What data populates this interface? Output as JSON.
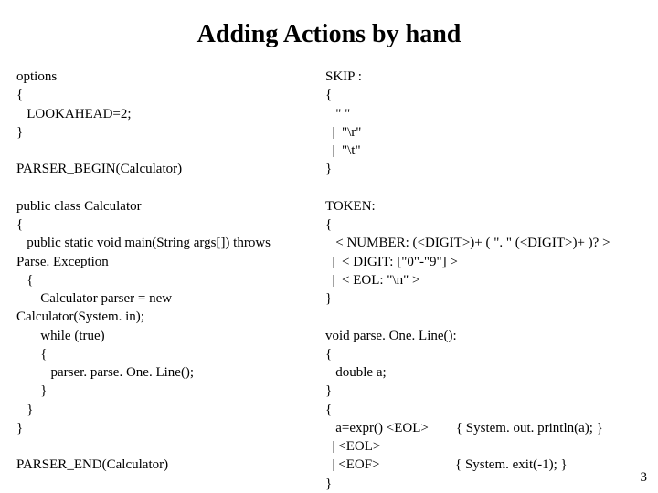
{
  "title": "Adding Actions by hand",
  "left": "options\n{\n   LOOKAHEAD=2;\n}\n\nPARSER_BEGIN(Calculator)\n\npublic class Calculator\n{\n   public static void main(String args[]) throws\nParse. Exception\n   {\n       Calculator parser = new\nCalculator(System. in);\n       while (true)\n       {\n          parser. parse. One. Line();\n       }\n   }\n}\n\nPARSER_END(Calculator)",
  "right": "SKIP :\n{\n   \" \"\n  |  \"\\r\"\n  |  \"\\t\"\n}\n\nTOKEN:\n{\n   < NUMBER: (<DIGIT>)+ ( \". \" (<DIGIT>)+ )? >\n  |  < DIGIT: [\"0\"-\"9\"] >\n  |  < EOL: \"\\n\" >\n}\n\nvoid parse. One. Line():\n{\n   double a;\n}\n{\n   a=expr() <EOL>        { System. out. println(a); }\n  | <EOL>\n  | <EOF>                      { System. exit(-1); }\n}",
  "page_number": "3"
}
